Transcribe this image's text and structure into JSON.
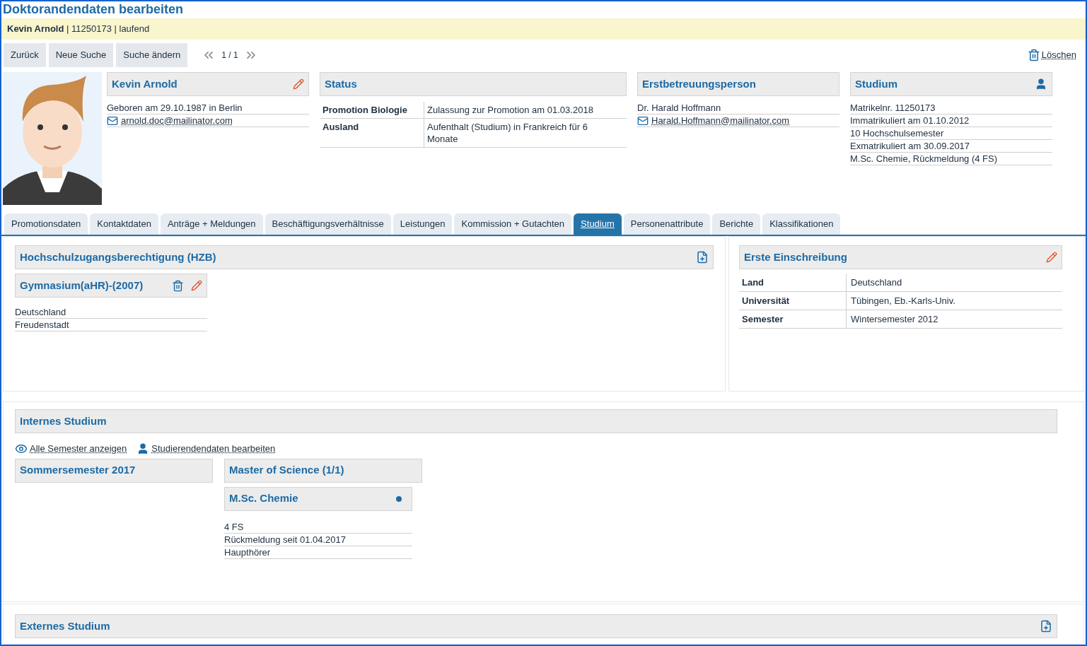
{
  "title": "Doktorandendaten bearbeiten",
  "person_bar": "**Kevin Arnold** | 11250173 | laufend",
  "toolbar": {
    "buttons": [
      "Zurück",
      "Neue Suche",
      "Suche ändern"
    ],
    "pager": "1 / 1",
    "delete": "Löschen"
  },
  "person_card": {
    "title": "Kevin Arnold",
    "birth": "Geboren am 29.10.1987 in Berlin",
    "email": "arnold.doc@mailinator.com"
  },
  "status_card": {
    "title": "Status",
    "rows": [
      {
        "label": "Promotion Biologie",
        "value": "Zulassung zur Promotion am 01.03.2018"
      },
      {
        "label": "Ausland",
        "value": "Aufenthalt (Studium) in Frankreich für 6 Monate"
      }
    ]
  },
  "supervisor_card": {
    "title": "Erstbetreuungsperson",
    "name": "Dr. Harald Hoffmann",
    "email": "Harald.Hoffmann@mailinator.com"
  },
  "studium_card": {
    "title": "Studium",
    "lines": [
      "Matrikelnr. 11250173",
      "Immatrikuliert am 01.10.2012",
      "10 Hochschulsemester",
      "Exmatrikuliert am 30.09.2017",
      "M.Sc. Chemie, Rückmeldung (4 FS)"
    ]
  },
  "tabs": [
    {
      "label": "Promotionsdaten",
      "selected": false
    },
    {
      "label": "Kontaktdaten",
      "selected": false
    },
    {
      "label": "Anträge + Meldungen",
      "selected": false
    },
    {
      "label": "Beschäftigungsverhältnisse",
      "selected": false
    },
    {
      "label": "Leistungen",
      "selected": false
    },
    {
      "label": "Kommission + Gutachten",
      "selected": false
    },
    {
      "label": "Studium",
      "selected": true
    },
    {
      "label": "Personenattribute",
      "selected": false
    },
    {
      "label": "Berichte",
      "selected": false
    },
    {
      "label": "Klassifikationen",
      "selected": false
    }
  ],
  "hzb": {
    "title": "Hochschulzugangsberechtigung (HZB)",
    "entry": {
      "title": "Gymnasium(aHR)-(2007)",
      "lines": [
        "Deutschland",
        "Freudenstadt"
      ]
    }
  },
  "first_enrollment": {
    "title": "Erste Einschreibung",
    "rows": [
      {
        "label": "Land",
        "value": "Deutschland"
      },
      {
        "label": "Universität",
        "value": "Tübingen, Eb.-Karls-Univ."
      },
      {
        "label": "Semester",
        "value": "Wintersemester 2012"
      }
    ]
  },
  "internal": {
    "title": "Internes Studium",
    "links": [
      {
        "kind": "show",
        "label": "Alle Semester anzeigen"
      },
      {
        "kind": "edit",
        "label": "Studierendendaten bearbeiten"
      }
    ],
    "semester": "Sommersemester 2017",
    "degree": {
      "title": "Master of Science (1/1)",
      "subject": {
        "title": "M.Sc. Chemie",
        "lines": [
          "4 FS",
          "Rückmeldung seit 01.04.2017",
          "Haupthörer"
        ]
      }
    }
  },
  "external": {
    "title": "Externes Studium"
  }
}
